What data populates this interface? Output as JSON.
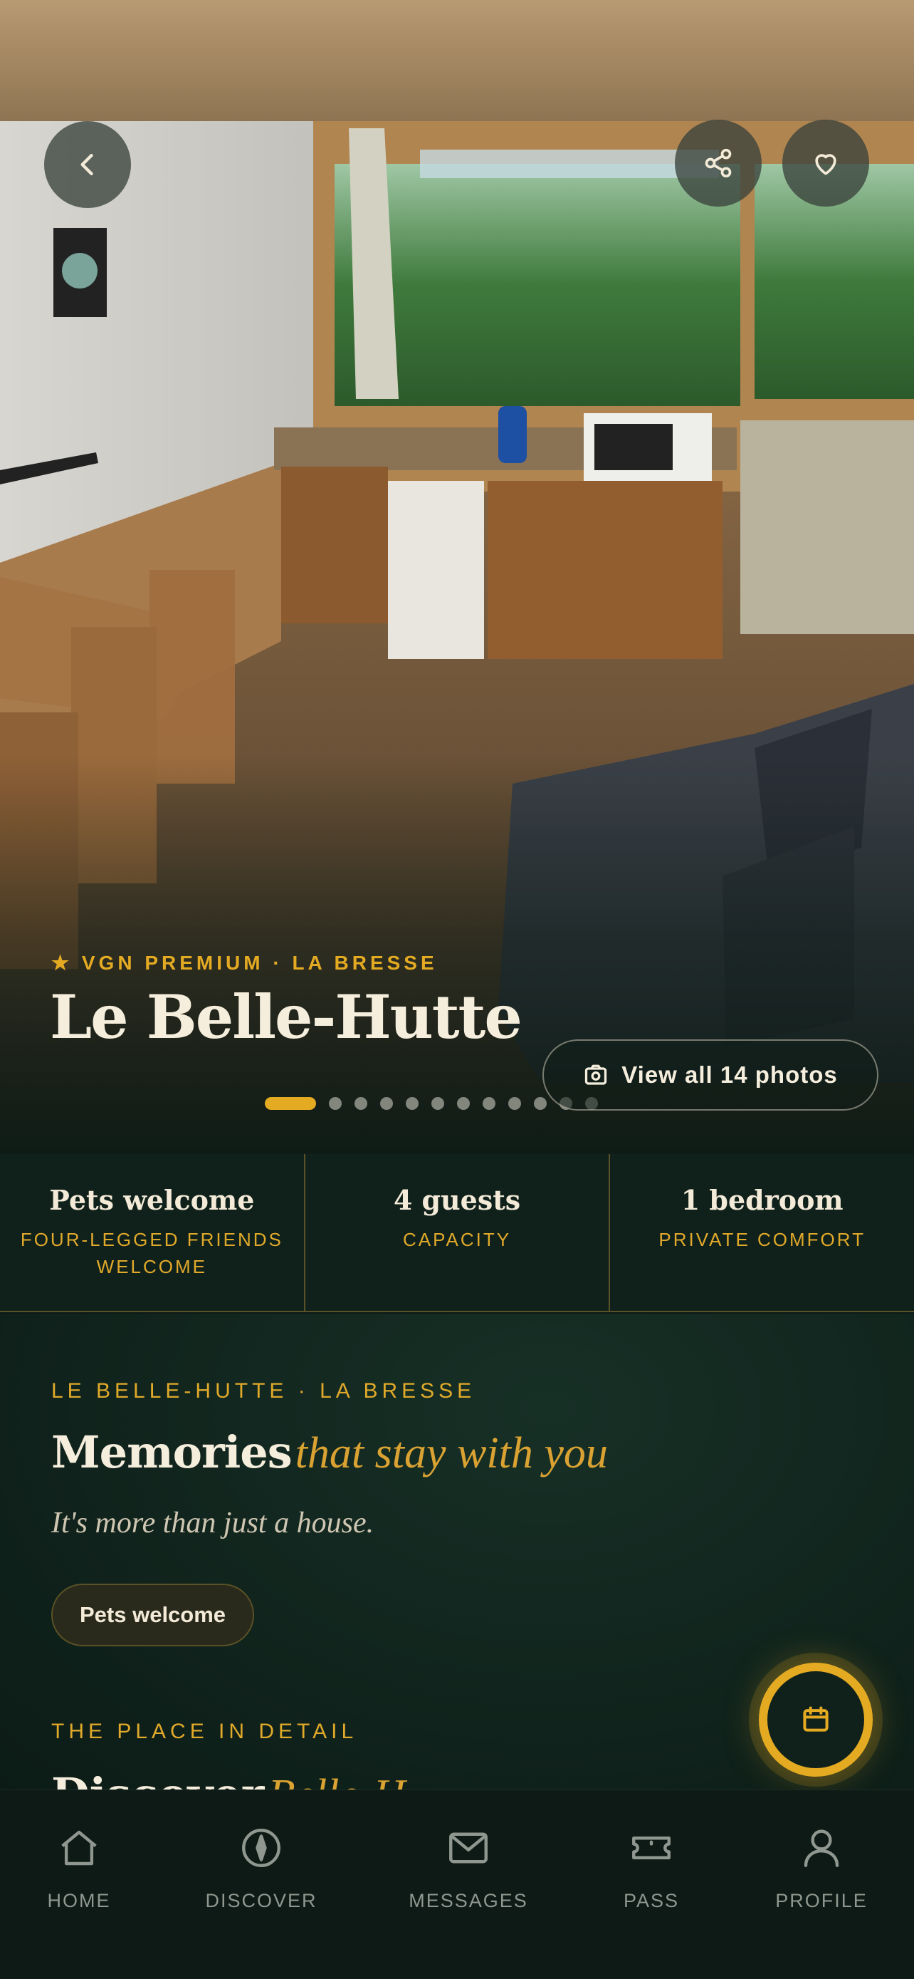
{
  "hero": {
    "eyebrow": "★ VGN PREMIUM · LA BRESSE",
    "title": "Le Belle-Hutte",
    "photos_button": "View all 14 photos",
    "photo_count": 14,
    "active_photo_index": 0,
    "visible_dot_count": 12
  },
  "header": {
    "back_icon": "chevron-left-icon",
    "share_icon": "share-icon",
    "favorite_icon": "heart-icon"
  },
  "stats": [
    {
      "title": "Pets welcome",
      "subtitle": "FOUR-LEGGED FRIENDS WELCOME"
    },
    {
      "title": "4 guests",
      "subtitle": "CAPACITY"
    },
    {
      "title": "1 bedroom",
      "subtitle": "PRIVATE COMFORT"
    }
  ],
  "intro": {
    "eyebrow": "LE BELLE-HUTTE · LA BRESSE",
    "heading_strong": "Memories",
    "heading_accent": "that stay with you",
    "tagline": "It's more than just a house.",
    "chip": "Pets welcome"
  },
  "detail": {
    "eyebrow": "THE PLACE IN DETAIL",
    "heading_strong": "Discover",
    "heading_accent": "Belle-H"
  },
  "fab": {
    "icon": "calendar-icon"
  },
  "nav": {
    "items": [
      {
        "label": "HOME",
        "icon": "home-icon"
      },
      {
        "label": "DISCOVER",
        "icon": "compass-icon"
      },
      {
        "label": "MESSAGES",
        "icon": "mail-icon"
      },
      {
        "label": "PASS",
        "icon": "ticket-icon"
      },
      {
        "label": "PROFILE",
        "icon": "user-icon"
      }
    ]
  },
  "colors": {
    "accent": "#e4ab22",
    "background": "#0c1a15",
    "panel": "#10211b",
    "text": "#f3ead8",
    "muted": "#8f9790"
  }
}
